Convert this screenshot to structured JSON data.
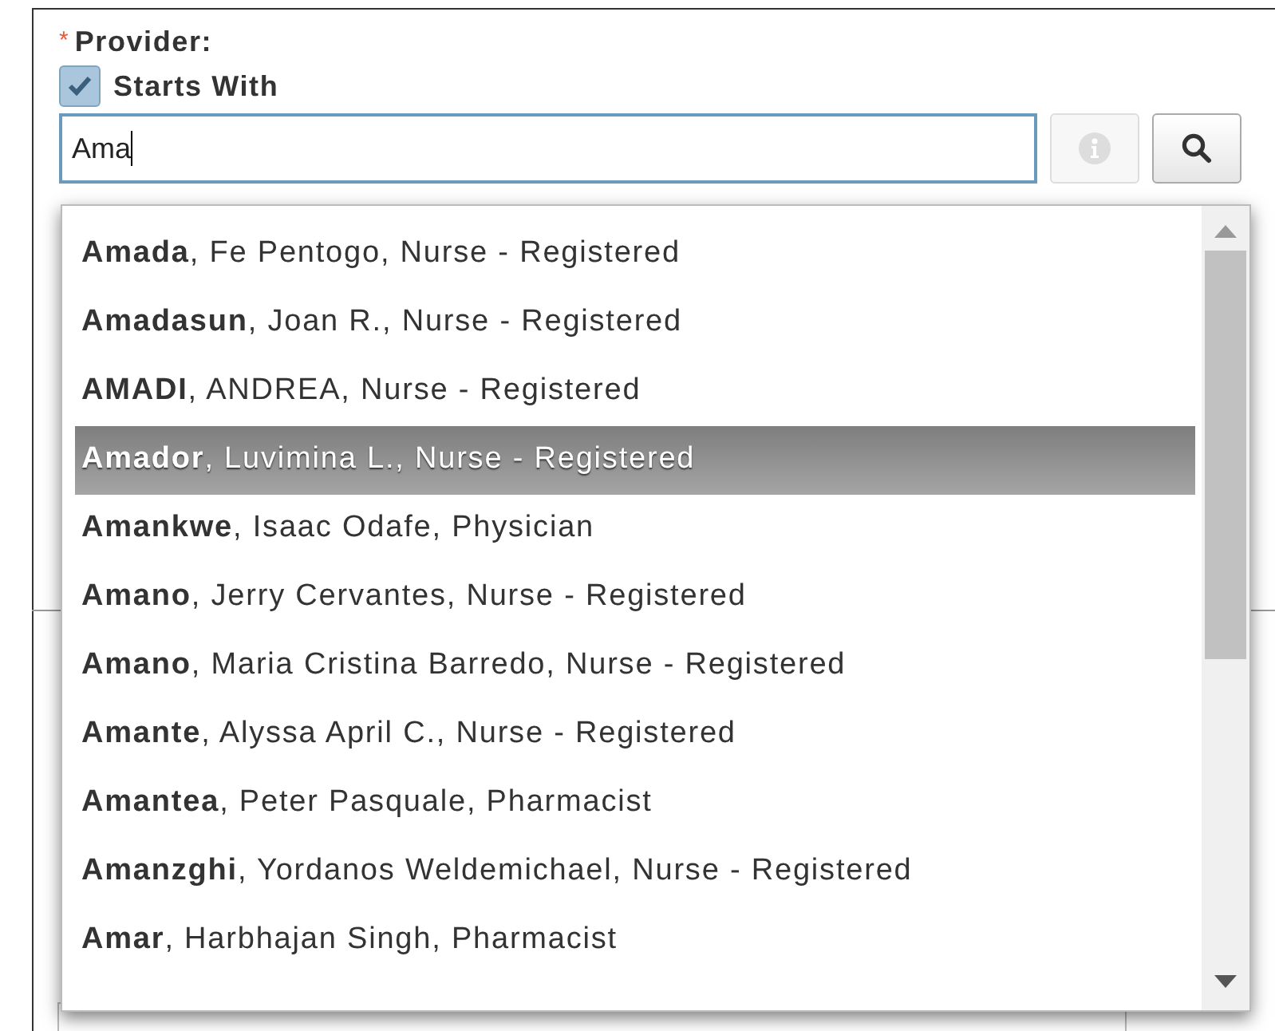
{
  "field": {
    "label": "Provider:",
    "required_mark": "*",
    "starts_with": {
      "label": "Starts With",
      "checked": true
    },
    "value": "Ama"
  },
  "suggestions": [
    {
      "text": "**Amada**, Fe Pentogo, Nurse - Registered",
      "selected": false
    },
    {
      "text": "**Amadasun**, Joan R., Nurse - Registered",
      "selected": false
    },
    {
      "text": "**AMADI**, ANDREA, Nurse - Registered",
      "selected": false
    },
    {
      "text": "**Amador**, Luvimina L., Nurse - Registered",
      "selected": true
    },
    {
      "text": "**Amankwe**, Isaac Odafe, Physician",
      "selected": false
    },
    {
      "text": "**Amano**, Jerry Cervantes, Nurse - Registered",
      "selected": false
    },
    {
      "text": "**Amano**, Maria Cristina Barredo, Nurse - Registered",
      "selected": false
    },
    {
      "text": "**Amante**, Alyssa April C., Nurse - Registered",
      "selected": false
    },
    {
      "text": "**Amantea**, Peter Pasquale, Pharmacist",
      "selected": false
    },
    {
      "text": "**Amanzghi**, Yordanos Weldemichael, Nurse - Registered",
      "selected": false
    },
    {
      "text": "**Amar**, Harbhajan Singh, Pharmacist",
      "selected": false
    }
  ]
}
